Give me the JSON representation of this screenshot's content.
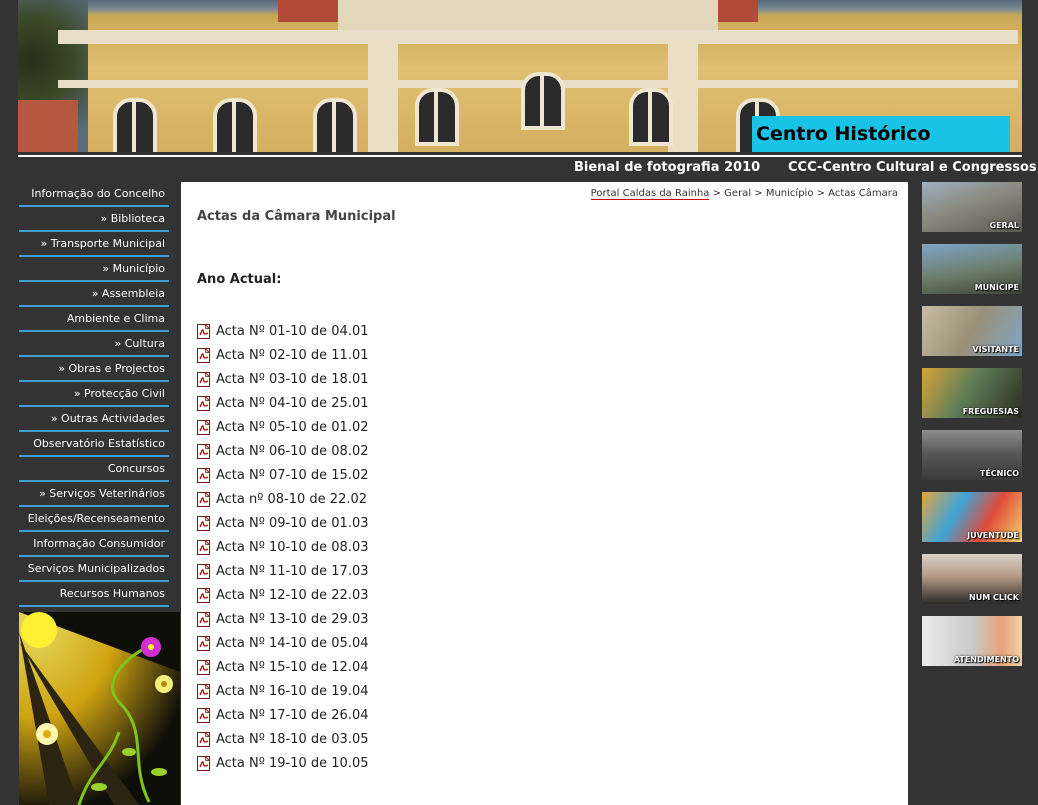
{
  "header": {
    "banner_title": "Centro Histórico",
    "links": [
      "Bienal de fotografia 2010",
      "CCC-Centro Cultural e Congressos"
    ]
  },
  "leftnav": {
    "items": [
      "Informação do Concelho",
      "» Biblioteca",
      "» Transporte Municipal",
      "» Município",
      "» Assembleia",
      "Ambiente e Clima",
      "» Cultura",
      "» Obras e Projectos",
      "» Protecção Civil",
      "» Outras Actividades",
      "Observatório Estatístico",
      "Concursos",
      "» Serviços Veterinários",
      "Eleições/Recenseamento",
      "Informação Consumidor",
      "Serviços Municipalizados",
      "Recursos Humanos"
    ]
  },
  "breadcrumb": {
    "home": "Portal Caldas da Rainha",
    "rest": " > Geral > Município > Actas Câmara"
  },
  "main": {
    "title": "Actas da Câmara Municipal",
    "section": "Ano Actual:",
    "actas": [
      "Acta Nº 01-10 de 04.01",
      "Acta Nº 02-10 de 11.01",
      "Acta Nº 03-10 de 18.01",
      "Acta Nº 04-10 de 25.01",
      "Acta Nº 05-10 de 01.02",
      "Acta Nº 06-10 de 08.02",
      "Acta Nº 07-10 de 15.02",
      "Acta nº 08-10 de 22.02",
      "Acta Nº 09-10 de 01.03",
      "Acta Nº 10-10 de 08.03",
      "Acta Nº 11-10 de 17.03",
      "Acta Nº 12-10 de 22.03",
      "Acta Nº 13-10 de 29.03",
      "Acta Nº 14-10 de 05.04",
      "Acta Nº 15-10 de 12.04",
      "Acta Nº 16-10 de 19.04",
      "Acta Nº 17-10 de 26.04",
      "Acta Nº 18-10 de 03.05",
      "Acta Nº 19-10 de 10.05"
    ]
  },
  "rightnav": {
    "tiles": [
      "GERAL",
      "MUNÍCIPE",
      "VISITANTE",
      "FREGUESIAS",
      "TÉCNICO",
      "JUVENTUDE",
      "NUM CLICK",
      "ATENDIMENTO"
    ]
  },
  "colors": {
    "background": "#333333",
    "nav_separator": "#3b9fd3",
    "banner_label_bg": "#19c3e6"
  },
  "icons": {
    "acta_icon": "pdf-file-icon"
  }
}
